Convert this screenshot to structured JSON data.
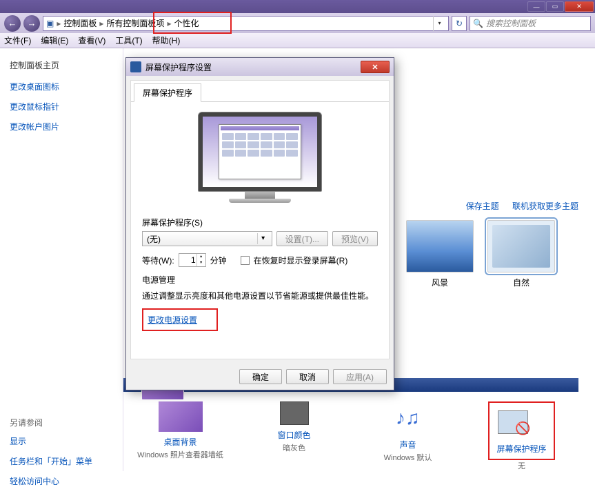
{
  "window": {
    "minimize": "—",
    "maximize": "▭",
    "close": "✕"
  },
  "address": {
    "root_icon": "▣",
    "crumb1": "控制面板",
    "crumb2": "所有控制面板项",
    "crumb3": "个性化",
    "sep": "▸",
    "drop": "▾",
    "refresh": "↻"
  },
  "search": {
    "placeholder": "搜索控制面板",
    "icon": "🔍"
  },
  "menu": {
    "file": "文件(F)",
    "edit": "编辑(E)",
    "view": "查看(V)",
    "tools": "工具(T)",
    "help": "帮助(H)"
  },
  "sidebar": {
    "home": "控制面板主页",
    "links": [
      "更改桌面图标",
      "更改鼠标指针",
      "更改帐户图片"
    ],
    "seealso": "另请参阅",
    "seelinks": [
      "显示",
      "任务栏和「开始」菜单",
      "轻松访问中心"
    ]
  },
  "content": {
    "top_links": {
      "save": "保存主题",
      "online": "联机获取更多主题"
    },
    "themes": [
      {
        "name": "风景",
        "cls": "scenery"
      },
      {
        "name": "自然",
        "cls": "nature selected"
      }
    ],
    "bottom": [
      {
        "title": "桌面背景",
        "sub": "Windows 照片查看器墙纸",
        "icon": "bg"
      },
      {
        "title": "窗口颜色",
        "sub": "暗灰色",
        "icon": "color"
      },
      {
        "title": "声音",
        "sub": "Windows 默认",
        "icon": "sound",
        "glyph": "♪♫"
      },
      {
        "title": "屏幕保护程序",
        "sub": "无",
        "icon": "ssaver",
        "glyph": "🚫",
        "highlight": true
      }
    ]
  },
  "dialog": {
    "title": "屏幕保护程序设置",
    "tab": "屏幕保护程序",
    "section_label": "屏幕保护程序(S)",
    "combo_value": "(无)",
    "btn_settings": "设置(T)...",
    "btn_preview": "预览(V)",
    "wait_label": "等待(W):",
    "wait_value": "1",
    "wait_unit": "分钟",
    "resume_chk": "在恢复时显示登录屏幕(R)",
    "power_title": "电源管理",
    "power_desc": "通过调整显示亮度和其他电源设置以节省能源或提供最佳性能。",
    "power_link": "更改电源设置",
    "ok": "确定",
    "cancel": "取消",
    "apply": "应用(A)"
  }
}
